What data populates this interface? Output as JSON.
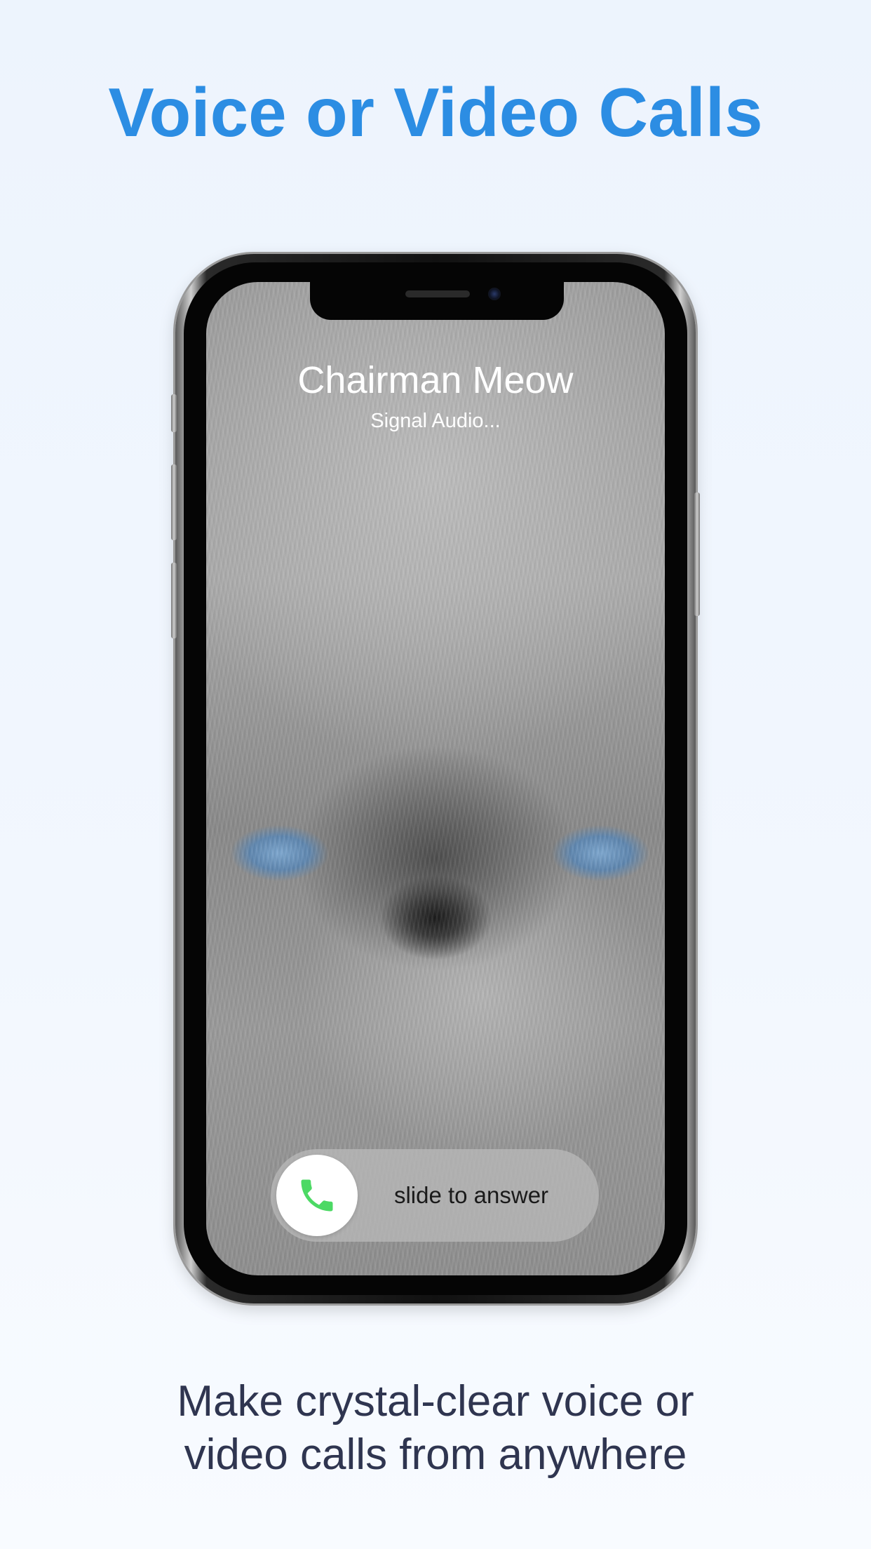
{
  "headline": "Voice or Video Calls",
  "call": {
    "caller_name": "Chairman Meow",
    "status": "Signal Audio...",
    "slider_label": "slide to answer"
  },
  "subline": {
    "line1": "Make crystal-clear voice or",
    "line2": "video calls from anywhere"
  },
  "colors": {
    "headline": "#2c8de3",
    "answer_green": "#4cd964",
    "subline": "#2f3550"
  },
  "icons": {
    "answer": "phone-icon"
  }
}
